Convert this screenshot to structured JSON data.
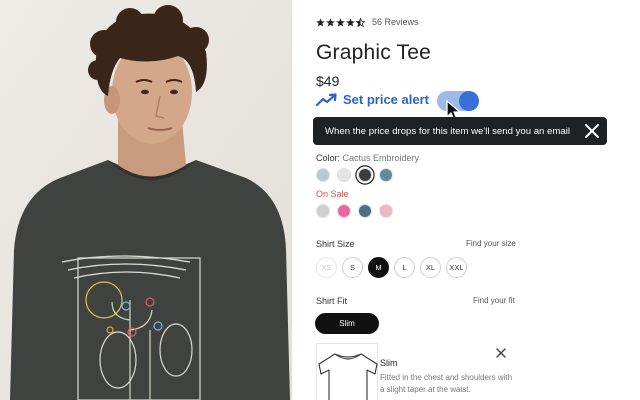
{
  "product": {
    "rating_stars": 4.5,
    "reviews": "56 Reviews",
    "title": "Graphic Tee",
    "price": "$49"
  },
  "price_alert": {
    "label": "Set price alert",
    "enabled": true,
    "tooltip": "When the price drops for this item we'll send you an email",
    "accent_color": "#2f63c9"
  },
  "color": {
    "label": "Color:",
    "value": "Cactus Embroidery",
    "swatches": [
      {
        "name": "light-blue",
        "color": "#b7c9d1"
      },
      {
        "name": "light-grey",
        "color": "#e4e4e4"
      },
      {
        "name": "charcoal",
        "color": "#3a3d3b",
        "selected": true
      },
      {
        "name": "teal",
        "color": "#5e8d99"
      }
    ],
    "sale_label": "On Sale",
    "sale_swatches": [
      {
        "name": "tie-dye-grey",
        "color": "#cfcfcf"
      },
      {
        "name": "pink-floral",
        "color": "#e86a9c"
      },
      {
        "name": "blue-print",
        "color": "#4e6e86"
      },
      {
        "name": "pink",
        "color": "#f0b7c0"
      }
    ]
  },
  "size": {
    "label": "Shirt Size",
    "link": "Find your size",
    "options": [
      {
        "label": "XS",
        "available": false
      },
      {
        "label": "S",
        "available": true
      },
      {
        "label": "M",
        "available": true,
        "selected": true
      },
      {
        "label": "L",
        "available": true
      },
      {
        "label": "XL",
        "available": true
      },
      {
        "label": "XXL",
        "available": true
      }
    ]
  },
  "fit": {
    "label": "Shirt Fit",
    "link": "Find your fit",
    "selected": "Slim",
    "card_title": "Slim",
    "card_desc": "Fitted in the chest and shoulders with a slight taper at the waist."
  }
}
